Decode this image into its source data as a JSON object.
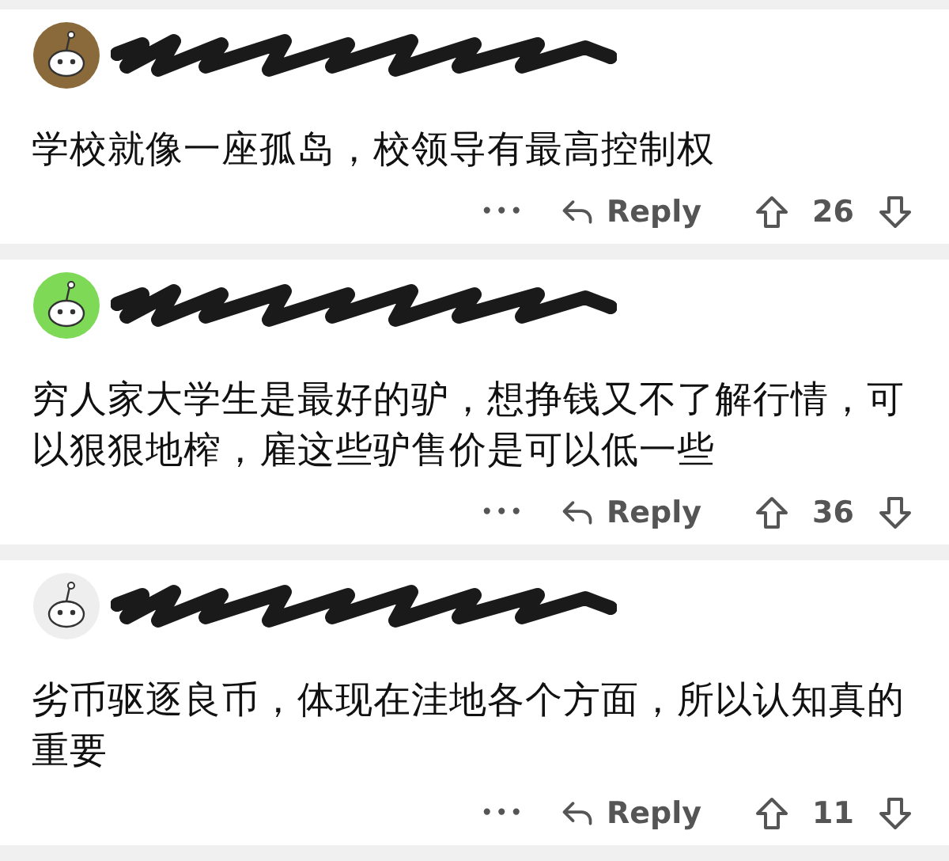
{
  "comments": [
    {
      "color": "#8a6a3a",
      "text": "学校就像一座孤岛，校领导有最高控制权",
      "more": "•••",
      "reply": "Reply",
      "votes": "26"
    },
    {
      "color": "#7ed957",
      "text": "穷人家大学生是最好的驴，想挣钱又不了解行情，可以狠狠地榨，雇这些驴售价是可以低一些",
      "more": "•••",
      "reply": "Reply",
      "votes": "36"
    },
    {
      "color": "#eeeeee",
      "text": "劣币驱逐良币，体现在洼地各个方面，所以认知真的重要",
      "more": "•••",
      "reply": "Reply",
      "votes": "11"
    }
  ]
}
